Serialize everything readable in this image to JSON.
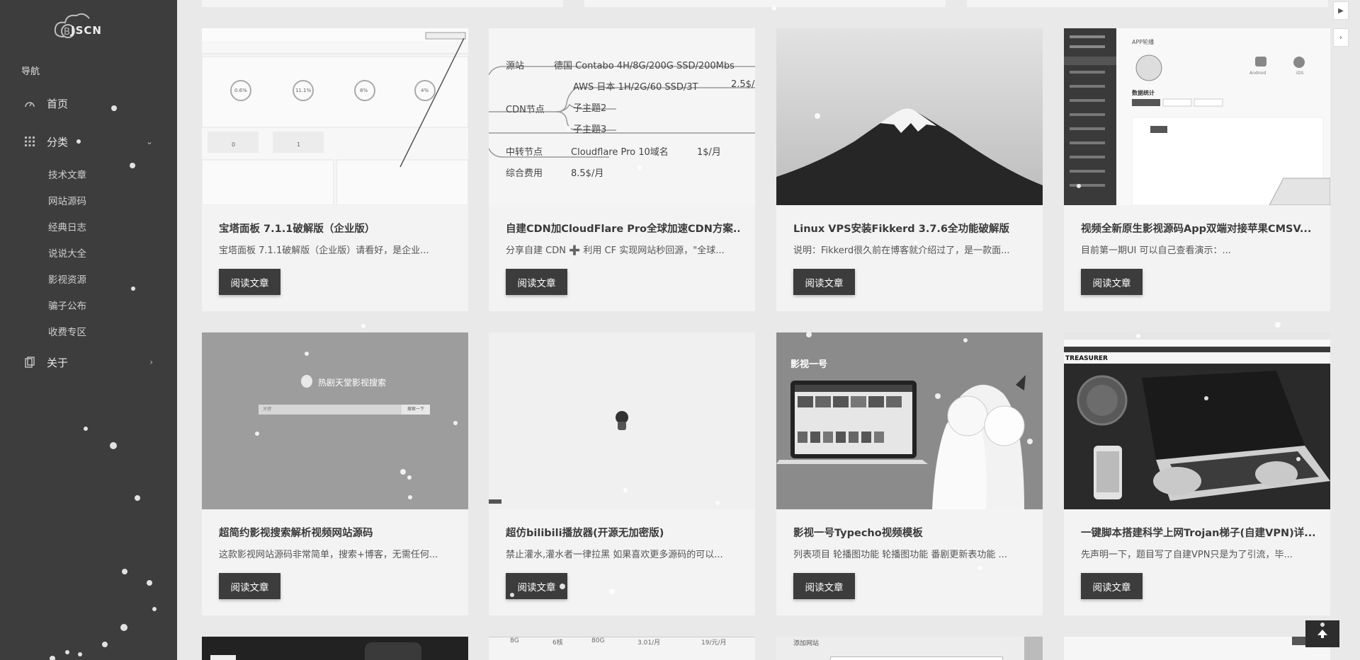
{
  "brand": {
    "logo_text": "JSCN"
  },
  "nav": {
    "title": "导航",
    "items": [
      {
        "label": "首页"
      },
      {
        "label": "分类",
        "sub": [
          "技术文章",
          "网站源码",
          "经典日志",
          "说说大全",
          "影视资源",
          "骗子公布",
          "收费专区"
        ]
      },
      {
        "label": "关于"
      }
    ]
  },
  "read_label": "阅读文章",
  "cards": [
    {
      "title": "宝塔面板 7.1.1破解版（企业版）",
      "excerpt": "宝塔面板 7.1.1破解版（企业版）请看好，是企业..."
    },
    {
      "title": "自建CDN加CloudFlare Pro全球加速CDN方案...",
      "excerpt": "分享自建 CDN ➕ 利用 CF 实现网站秒回源，\"全球..."
    },
    {
      "title": "Linux VPS安装Fikkerd 3.7.6全功能破解版",
      "excerpt": "说明：Fikkerd很久前在博客就介绍过了，是一款面..."
    },
    {
      "title": "视频全新原生影视源码App双端对接苹果CMSV...",
      "excerpt": "目前第一期UI 可以自己查看演示：..."
    },
    {
      "title": "超简约影视搜索解析视频网站源码",
      "excerpt": "这款影视网站源码非常简单，搜索+博客，无需任何..."
    },
    {
      "title": "超仿bilibili播放器(开源无加密版)",
      "excerpt": "禁止灌水,灌水者一律拉黑 如果喜欢更多源码的可以..."
    },
    {
      "title": "影视一号Typecho视频模板",
      "excerpt": "列表项目 轮播图功能 轮播图功能 番剧更新表功能 ..."
    },
    {
      "title": "一键脚本搭建科学上网Trojan梯子(自建VPN)详...",
      "excerpt": "先声明一下，题目写了自建VPN只是为了引流，毕..."
    }
  ],
  "thumbs": {
    "mindmap": {
      "rows": [
        {
          "label": "源站",
          "detail": "德国 Contabo  4H/8G/200G SSD/200Mbs"
        },
        {
          "label": "",
          "detail": "AWS 日本 1H/2G/60 SSD/3T",
          "extra": "2.5$/"
        },
        {
          "label": "CDN节点",
          "detail": "子主题2"
        },
        {
          "label": "",
          "detail": "子主题3"
        },
        {
          "label": "中转节点",
          "detail": "Cloudflare Pro 10域名",
          "extra": "1$/月"
        },
        {
          "label": "综合费用",
          "detail": "8.5$/月"
        }
      ]
    },
    "search": {
      "title": "热剧天堂影视搜索",
      "button": "搜索一下",
      "placeholder": "关键"
    },
    "yingshi": {
      "title": "影视一号"
    },
    "treasurer": {
      "brand": "TREASURER"
    },
    "panel": {
      "cells": [
        "0.6%",
        "11.1%",
        "8%",
        "4%"
      ],
      "counts": [
        "0",
        "1"
      ]
    },
    "app": {
      "title": "APP轮播",
      "platforms": [
        "Android",
        "iOS"
      ],
      "stats_title": "数据统计"
    },
    "bottom_table": [
      "8G",
      "6核",
      "80G",
      "3.01/月",
      "19/元/月"
    ],
    "bottom_site": "添加网站"
  }
}
